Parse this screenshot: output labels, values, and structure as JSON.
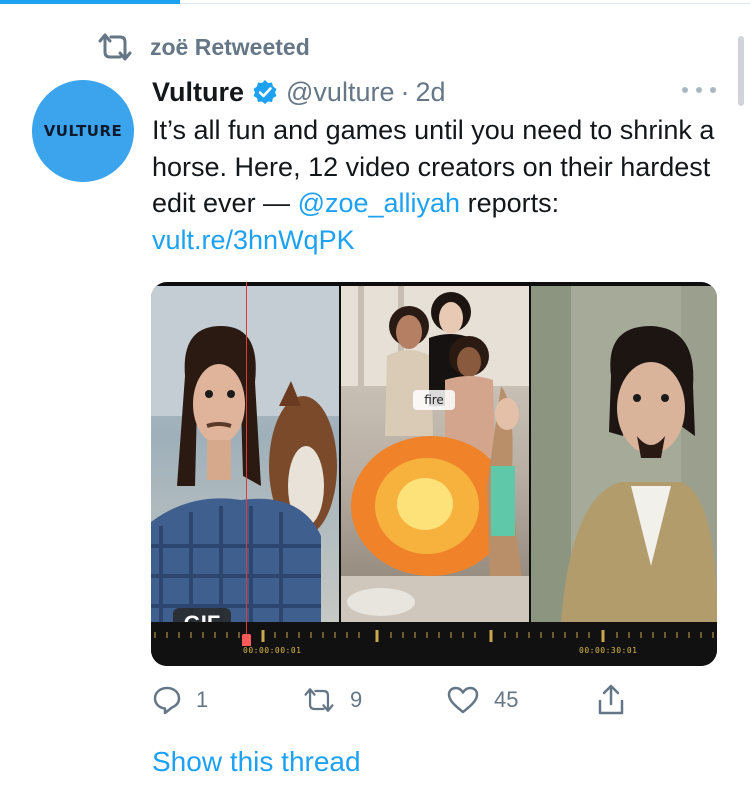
{
  "retweet": {
    "label": "zoë Retweeted"
  },
  "author": {
    "avatar_text": "VULTURE",
    "name": "Vulture",
    "handle": "@vulture",
    "separator": "·",
    "time": "2d"
  },
  "tweet": {
    "text_before": "It’s all fun and games until you need to shrink a horse. Here, 12 video creators on their hardest edit ever — ",
    "mention": "@zoe_alliyah",
    "text_middle": " reports: ",
    "link": "vult.re/3hnWqPK"
  },
  "media": {
    "badge": "GIF",
    "timecode_left": "00:00:00:01",
    "timecode_right": "00:00:30:01",
    "caption_label": "fire"
  },
  "actions": {
    "reply_count": "1",
    "retweet_count": "9",
    "like_count": "45"
  },
  "show_thread": "Show this thread",
  "colors": {
    "accent": "#1da1f2",
    "muted": "#657786"
  }
}
